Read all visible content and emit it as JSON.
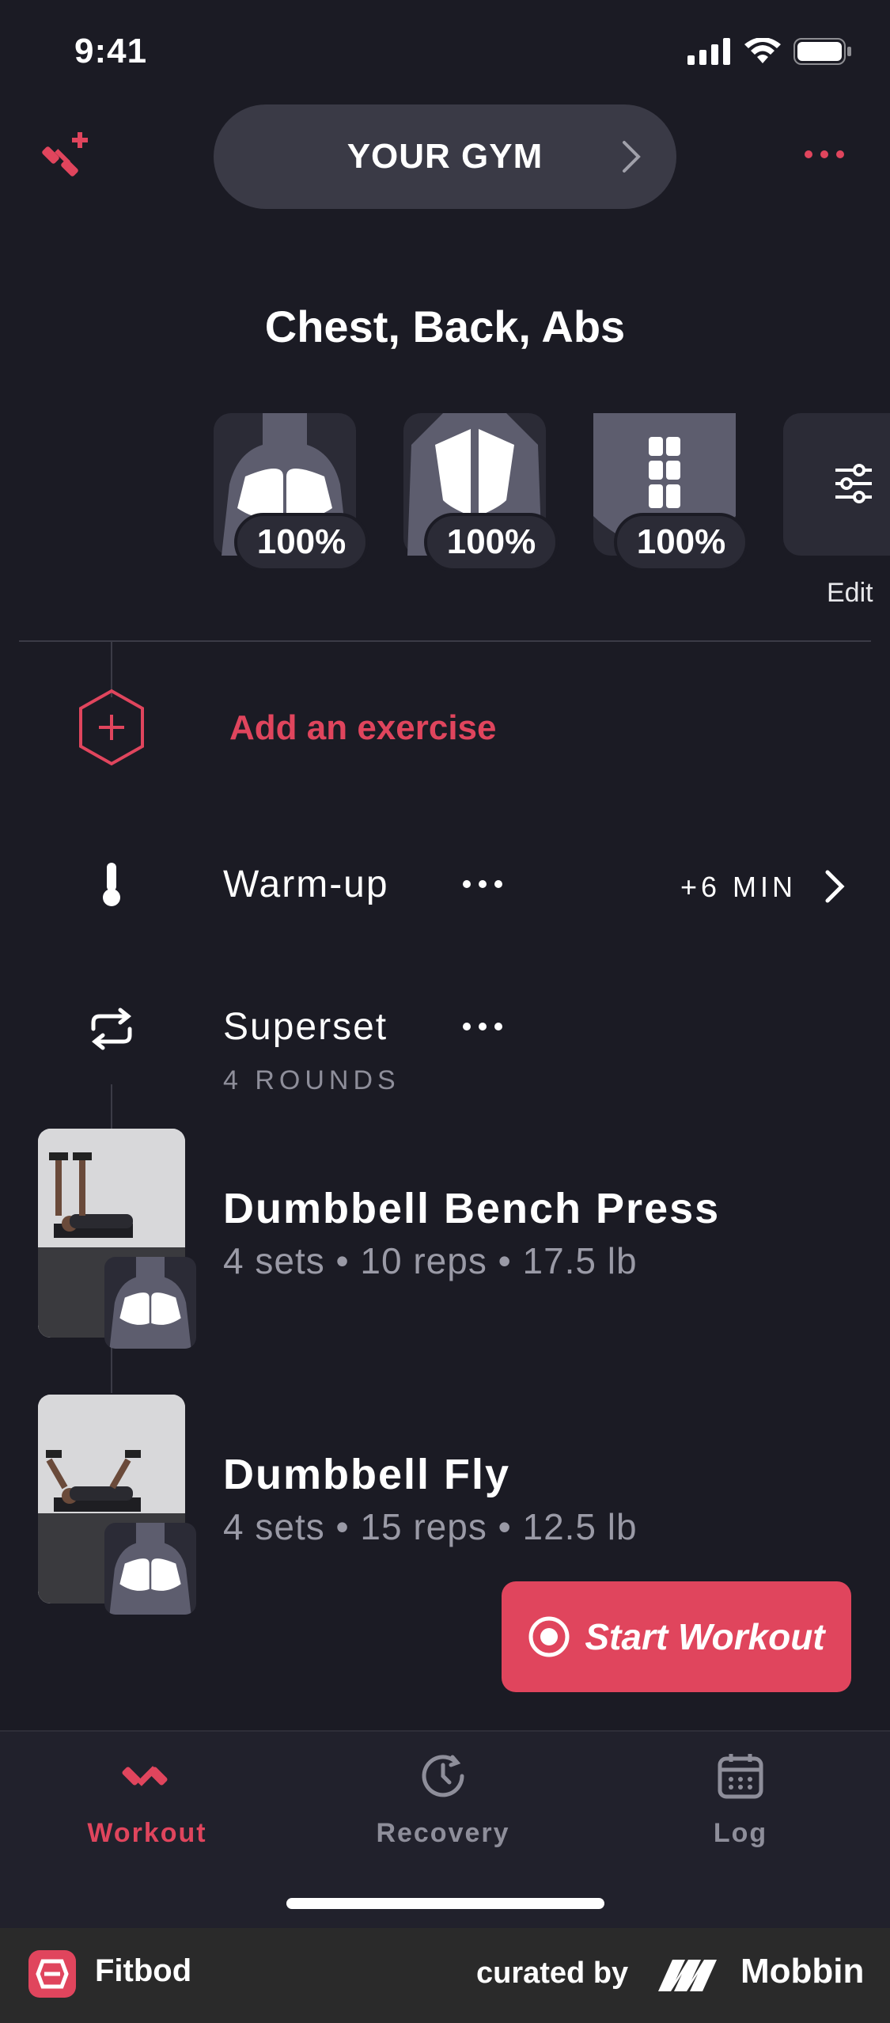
{
  "status": {
    "time": "9:41"
  },
  "header": {
    "gym_label": "YOUR GYM"
  },
  "workout": {
    "title": "Chest, Back, Abs",
    "muscles": [
      {
        "name": "chest",
        "recovery": "100%"
      },
      {
        "name": "back",
        "recovery": "100%"
      },
      {
        "name": "abs",
        "recovery": "100%"
      }
    ],
    "edit_label": "Edit",
    "add_exercise": "Add an exercise",
    "warmup": {
      "label": "Warm-up",
      "duration": "+6 MIN"
    },
    "superset": {
      "label": "Superset",
      "rounds": "4 ROUNDS"
    },
    "exercises": [
      {
        "name": "Dumbbell Bench Press",
        "detail": "4 sets • 10 reps • 17.5 lb"
      },
      {
        "name": "Dumbbell Fly",
        "detail": "4 sets • 15 reps • 12.5 lb"
      }
    ],
    "start_button": "Start Workout"
  },
  "tabs": [
    {
      "label": "Workout",
      "icon": "dumbbell-icon",
      "active": true
    },
    {
      "label": "Recovery",
      "icon": "recovery-clock-icon",
      "active": false
    },
    {
      "label": "Log",
      "icon": "calendar-icon",
      "active": false
    }
  ],
  "footer": {
    "app_name": "Fitbod",
    "curated_by": "curated by",
    "brand": "Mobbin"
  },
  "colors": {
    "accent": "#e0455d",
    "background": "#1b1b24",
    "card": "#2b2b36"
  }
}
